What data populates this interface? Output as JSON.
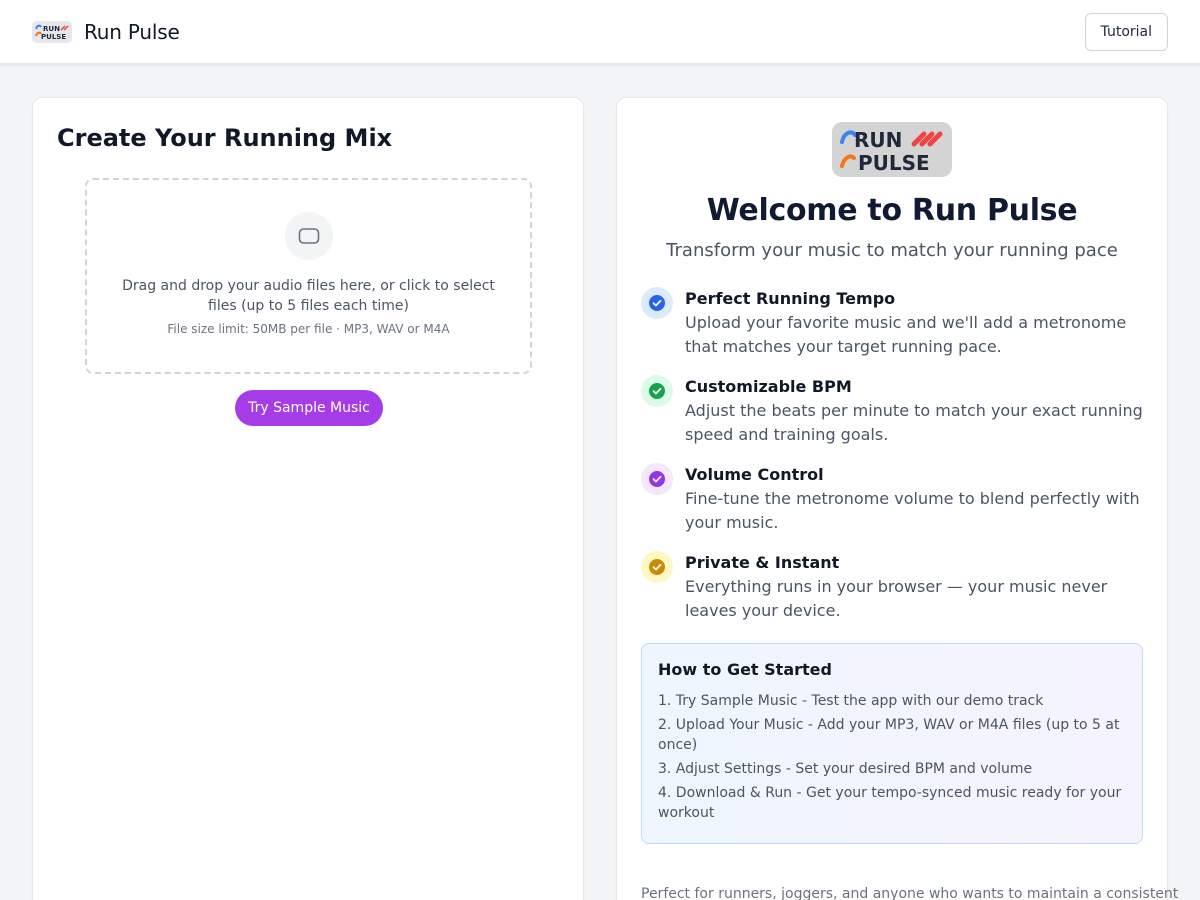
{
  "header": {
    "title": "Run Pulse",
    "tutorial_label": "Tutorial",
    "logo_line1": "RUN",
    "logo_line2": "PULSE"
  },
  "upload": {
    "title": "Create Your Running Mix",
    "drop_text": "Drag and drop your audio files here, or click to select files (up to 5 files each time)",
    "limit_text": "File size limit: 50MB per file · MP3, WAV or M4A",
    "icon": "upload-icon",
    "sample_button": "Try Sample Music"
  },
  "welcome": {
    "logo_line1": "RUN",
    "logo_line2": "PULSE",
    "heading": "Welcome to Run Pulse",
    "tagline": "Transform your music to match your running pace",
    "features": [
      {
        "title": "Perfect Running Tempo",
        "description": "Upload your favorite music and we'll add a metronome that matches your target running pace.",
        "icon": "check-circle-icon",
        "color": "#2563eb",
        "bg": "#dbeafe"
      },
      {
        "title": "Customizable BPM",
        "description": "Adjust the beats per minute to match your exact running speed and training goals.",
        "icon": "check-circle-icon",
        "color": "#16a34a",
        "bg": "#dcfce7"
      },
      {
        "title": "Volume Control",
        "description": "Fine-tune the metronome volume to blend perfectly with your music.",
        "icon": "check-circle-icon",
        "color": "#9333ea",
        "bg": "#f3e8ff"
      },
      {
        "title": "Private & Instant",
        "description": "Everything runs in your browser — your music never leaves your device.",
        "icon": "check-circle-icon",
        "color": "#ca8a04",
        "bg": "#fef9c3"
      }
    ],
    "how_to": {
      "title": "How to Get Started",
      "steps": [
        "1. Try Sample Music - Test the app with our demo track",
        "2. Upload Your Music - Add your MP3, WAV or M4A files (up to 5 at once)",
        "3. Adjust Settings - Set your desired BPM and volume",
        "4. Download & Run - Get your tempo-synced music ready for your workout"
      ]
    },
    "footer_note": "Perfect for runners, joggers, and anyone who wants to maintain a consistent"
  },
  "colors": {
    "accent_purple": "#a63be8",
    "heading_navy": "#111a33"
  }
}
